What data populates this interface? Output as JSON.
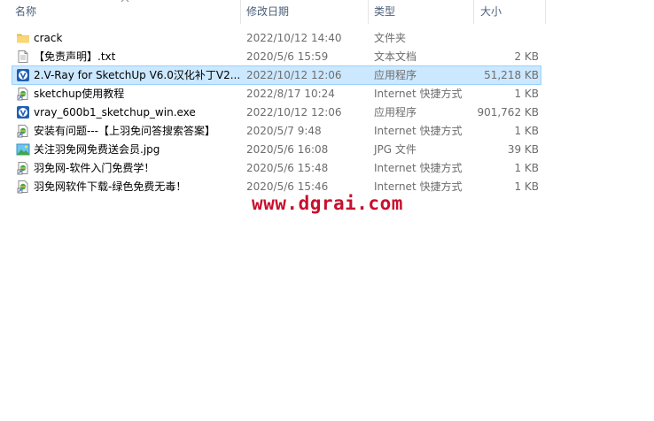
{
  "columns": {
    "name": "名称",
    "modified": "修改日期",
    "type": "类型",
    "size": "大小"
  },
  "files": [
    {
      "name": "crack",
      "modified": "2022/10/12 14:40",
      "type": "文件夹",
      "size": "",
      "icon": "folder-icon",
      "selected": false
    },
    {
      "name": "【免责声明】.txt",
      "modified": "2020/5/6 15:59",
      "type": "文本文档",
      "size": "2 KB",
      "icon": "text-file-icon",
      "selected": false
    },
    {
      "name": "2.V-Ray for SketchUp V6.0汉化补丁V2...",
      "modified": "2022/10/12 12:06",
      "type": "应用程序",
      "size": "51,218 KB",
      "icon": "vray-app-icon",
      "selected": true
    },
    {
      "name": "sketchup使用教程",
      "modified": "2022/8/17 10:24",
      "type": "Internet 快捷方式",
      "size": "1 KB",
      "icon": "internet-shortcut-icon",
      "selected": false
    },
    {
      "name": "vray_600b1_sketchup_win.exe",
      "modified": "2022/10/12 12:06",
      "type": "应用程序",
      "size": "901,762 KB",
      "icon": "vray-app-icon",
      "selected": false
    },
    {
      "name": "安装有问题---【上羽免问答搜索答案】",
      "modified": "2020/5/7 9:48",
      "type": "Internet 快捷方式",
      "size": "1 KB",
      "icon": "internet-shortcut-icon",
      "selected": false
    },
    {
      "name": "关注羽免网免费送会员.jpg",
      "modified": "2020/5/6 16:08",
      "type": "JPG 文件",
      "size": "39 KB",
      "icon": "image-file-icon",
      "selected": false
    },
    {
      "name": "羽免网-软件入门免费学！",
      "modified": "2020/5/6 15:48",
      "type": "Internet 快捷方式",
      "size": "1 KB",
      "icon": "internet-shortcut-icon",
      "selected": false
    },
    {
      "name": "羽免网软件下载-绿色免费无毒！",
      "modified": "2020/5/6 15:46",
      "type": "Internet 快捷方式",
      "size": "1 KB",
      "icon": "internet-shortcut-icon",
      "selected": false
    }
  ],
  "watermark": "www.dgrai.com",
  "colors": {
    "selection_bg": "#cce8ff",
    "selection_border": "#99d1ff",
    "folder": "#f8d775",
    "vray_blue": "#1f5fb4",
    "watermark": "#c8102e"
  }
}
